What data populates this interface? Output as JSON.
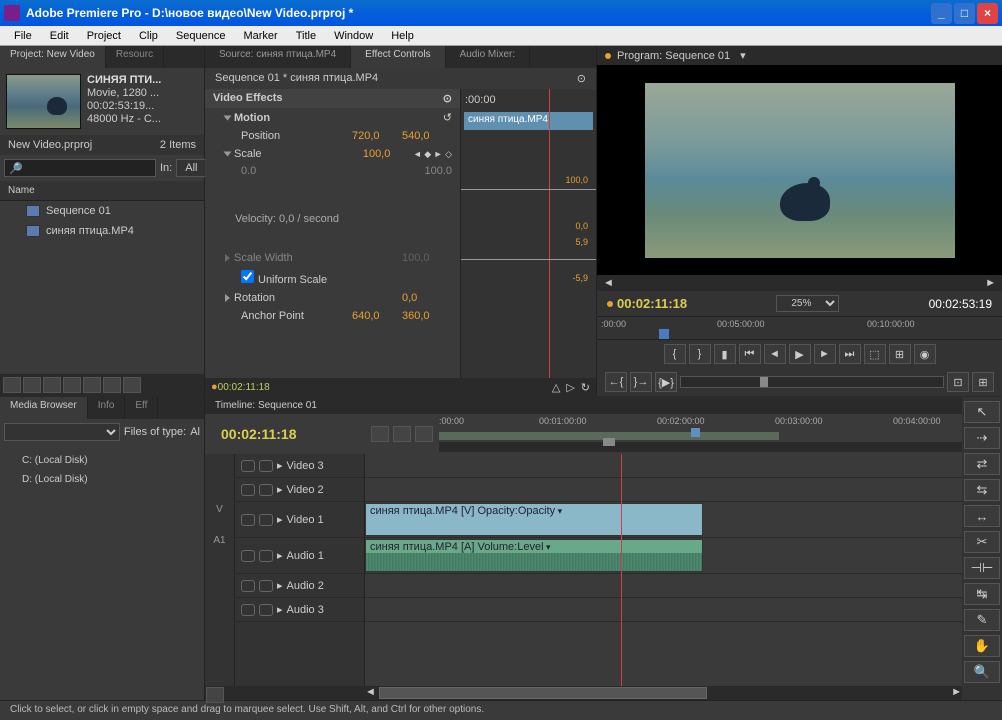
{
  "titlebar": {
    "text": "Adobe Premiere Pro - D:\\новое видео\\New Video.prproj *"
  },
  "menu": [
    "File",
    "Edit",
    "Project",
    "Clip",
    "Sequence",
    "Marker",
    "Title",
    "Window",
    "Help"
  ],
  "project": {
    "tab_project": "Project: New Video",
    "tab_resource": "Resourc",
    "clip_name": "СИНЯЯ ПТИ...",
    "clip_info1": "Movie, 1280 ...",
    "clip_info2": "00:02:53:19...",
    "clip_info3": "48000 Hz - C...",
    "project_file": "New Video.prproj",
    "item_count": "2 Items",
    "in_label": "In:",
    "in_value": "All",
    "col_name": "Name",
    "items": [
      "Sequence 01",
      "синяя птица.MP4"
    ]
  },
  "effect_controls": {
    "tab_source": "Source: синяя птица.MP4",
    "tab_effect": "Effect Controls",
    "tab_audio": "Audio Mixer: ",
    "header": "Sequence 01 * синяя птица.MP4",
    "tc_top": ":00:00",
    "clip_label": "синяя птица.MP4",
    "section_video": "Video Effects",
    "fx_motion": "Motion",
    "position_label": "Position",
    "position_x": "720,0",
    "position_y": "540,0",
    "scale_label": "Scale",
    "scale_val": "100,0",
    "scale_min": "0.0",
    "scale_max": "100.0",
    "scale_top": "100,0",
    "scale_g1": "0,0",
    "scale_g2": "5,9",
    "scale_g3": "-5,9",
    "velocity": "Velocity: 0,0 / second",
    "scalew_label": "Scale Width",
    "scalew_val": "100,0",
    "uniform": "Uniform Scale",
    "rotation_label": "Rotation",
    "rotation_val": "0,0",
    "anchor_label": "Anchor Point",
    "anchor_x": "640,0",
    "anchor_y": "360,0",
    "footer_tc": "00:02:11:18"
  },
  "program": {
    "title": "Program: Sequence 01",
    "tc_current": "00:02:11:18",
    "zoom": "25%",
    "tc_total": "00:02:53:19",
    "ruler": [
      ":00:00",
      "00:05:00:00",
      "00:10:00:00"
    ]
  },
  "media_browser": {
    "tab_mb": "Media Browser",
    "tab_info": "Info",
    "tab_eff": "Eff",
    "files_type": "Files of type:",
    "files_val": "Al",
    "drives": [
      "C: (Local Disk)",
      "D: (Local Disk)"
    ]
  },
  "timeline": {
    "header": "Timeline: Sequence 01",
    "tc": "00:02:11:18",
    "ruler": [
      ":00:00",
      "00:01:00:00",
      "00:02:00:00",
      "00:03:00:00",
      "00:04:00:00"
    ],
    "gutter_v": "V",
    "gutter_a": "A1",
    "tracks_v": [
      "Video 3",
      "Video 2",
      "Video 1"
    ],
    "tracks_a": [
      "Audio 1",
      "Audio 2",
      "Audio 3"
    ],
    "clip_v": "синяя птица.MP4 [V]  Opacity:Opacity",
    "clip_a": "синяя птица.MP4 [A]  Volume:Level"
  },
  "status": "Click to select, or click in empty space and drag to marquee select. Use Shift, Alt, and Ctrl for other options."
}
